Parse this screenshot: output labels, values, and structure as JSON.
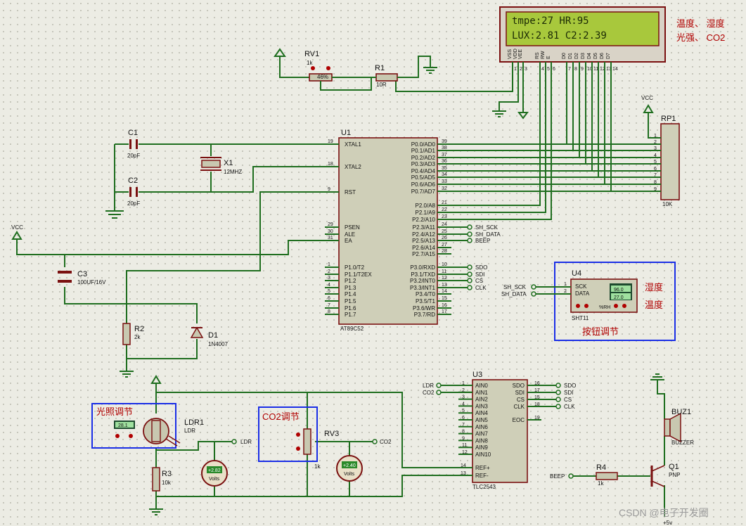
{
  "lcd": {
    "line1": "tmpe:27 HR:95",
    "line2": "LUX:2.81 C2:2.39",
    "pins": [
      "VSS",
      "VDD",
      "VEE",
      "RS",
      "RW",
      "E",
      "D0",
      "D1",
      "D2",
      "D3",
      "D4",
      "D5",
      "D6",
      "D7"
    ],
    "pin_numbers": [
      "1",
      "2",
      "3",
      "4",
      "5",
      "6",
      "7",
      "8",
      "9",
      "10",
      "11",
      "12",
      "13",
      "14"
    ]
  },
  "lcd_notes": {
    "line1": "温度、 湿度",
    "line2": "光强、 CO2"
  },
  "rv1": {
    "ref": "RV1",
    "value": "1k",
    "pct": "46%"
  },
  "r1": {
    "ref": "R1",
    "value": "10R"
  },
  "c1": {
    "ref": "C1",
    "value": "20pF"
  },
  "c2": {
    "ref": "C2",
    "value": "20pF"
  },
  "x1": {
    "ref": "X1",
    "value": "12MHZ"
  },
  "c3": {
    "ref": "C3",
    "value": "100UF/16V"
  },
  "r2": {
    "ref": "R2",
    "value": "2k"
  },
  "d1": {
    "ref": "D1",
    "value": "1N4007"
  },
  "vcc": "VCC",
  "rp1": {
    "ref": "RP1",
    "value": "10K",
    "pins": [
      "1",
      "2",
      "3",
      "4",
      "5",
      "6",
      "7",
      "8",
      "9"
    ]
  },
  "u1": {
    "ref": "U1",
    "part": "AT89C52",
    "left_pins": [
      {
        "n": "19",
        "l": "XTAL1"
      },
      {
        "n": "18",
        "l": "XTAL2"
      },
      {
        "n": "9",
        "l": "RST"
      },
      {
        "n": "29",
        "l": "PSEN"
      },
      {
        "n": "30",
        "l": "ALE"
      },
      {
        "n": "31",
        "l": "EA"
      },
      {
        "n": "1",
        "l": "P1.0/T2"
      },
      {
        "n": "2",
        "l": "P1.1/T2EX"
      },
      {
        "n": "3",
        "l": "P1.2"
      },
      {
        "n": "4",
        "l": "P1.3"
      },
      {
        "n": "5",
        "l": "P1.4"
      },
      {
        "n": "6",
        "l": "P1.5"
      },
      {
        "n": "7",
        "l": "P1.6"
      },
      {
        "n": "8",
        "l": "P1.7"
      }
    ],
    "right_pins": [
      {
        "n": "39",
        "l": "P0.0/AD0"
      },
      {
        "n": "38",
        "l": "P0.1/AD1"
      },
      {
        "n": "37",
        "l": "P0.2/AD2"
      },
      {
        "n": "36",
        "l": "P0.3/AD3"
      },
      {
        "n": "35",
        "l": "P0.4/AD4"
      },
      {
        "n": "34",
        "l": "P0.5/AD5"
      },
      {
        "n": "33",
        "l": "P0.6/AD6"
      },
      {
        "n": "32",
        "l": "P0.7/AD7"
      },
      {
        "n": "21",
        "l": "P2.0/A8"
      },
      {
        "n": "22",
        "l": "P2.1/A9"
      },
      {
        "n": "23",
        "l": "P2.2/A10"
      },
      {
        "n": "24",
        "l": "P2.3/A11"
      },
      {
        "n": "25",
        "l": "P2.4/A12"
      },
      {
        "n": "26",
        "l": "P2.5/A13"
      },
      {
        "n": "27",
        "l": "P2.6/A14"
      },
      {
        "n": "28",
        "l": "P2.7/A15"
      },
      {
        "n": "10",
        "l": "P3.0/RXD"
      },
      {
        "n": "11",
        "l": "P3.1/TXD"
      },
      {
        "n": "12",
        "l": "P3.2/INT0"
      },
      {
        "n": "13",
        "l": "P3.3/INT1"
      },
      {
        "n": "14",
        "l": "P3.4/T0"
      },
      {
        "n": "15",
        "l": "P3.5/T1"
      },
      {
        "n": "16",
        "l": "P3.6/WR"
      },
      {
        "n": "17",
        "l": "P3.7/RD"
      }
    ]
  },
  "u1_nets": {
    "p23": "SH_SCK",
    "p24": "SH_DATA",
    "p25": "BEEP",
    "p30": "SDO",
    "p31": "SDI",
    "p32": "CS",
    "p33": "CLK"
  },
  "u4": {
    "ref": "U4",
    "part": "SHT11",
    "sck": "SCK",
    "data": "DATA",
    "temp": "96.0",
    "hum": "27.0",
    "rh": "%RH",
    "net_sck": "SH_SCK",
    "net_data": "SH_DATA",
    "pin_sck": "1",
    "pin_data": "2",
    "note1": "湿度",
    "note2": "温度",
    "caption": "按钮调节"
  },
  "ldr1": {
    "ref": "LDR1",
    "value": "LDR",
    "display": "28.1",
    "caption": "光照调节"
  },
  "r3": {
    "ref": "R3",
    "value": "10k"
  },
  "vm1": {
    "value": "+2.82",
    "unit": "Volts"
  },
  "ldr_net": "LDR",
  "rv3": {
    "ref": "RV3",
    "value": "1k",
    "caption": "CO2调节"
  },
  "vm2": {
    "value": "+2.40",
    "unit": "Volts"
  },
  "co2_net": "CO2",
  "u3": {
    "ref": "U3",
    "part": "TLC2543",
    "left_pins": [
      {
        "n": "1",
        "l": "AIN0"
      },
      {
        "n": "2",
        "l": "AIN1"
      },
      {
        "n": "3",
        "l": "AIN2"
      },
      {
        "n": "4",
        "l": "AIN3"
      },
      {
        "n": "5",
        "l": "AIN4"
      },
      {
        "n": "6",
        "l": "AIN5"
      },
      {
        "n": "7",
        "l": "AIN6"
      },
      {
        "n": "8",
        "l": "AIN7"
      },
      {
        "n": "9",
        "l": "AIN8"
      },
      {
        "n": "11",
        "l": "AIN9"
      },
      {
        "n": "12",
        "l": "AIN10"
      }
    ],
    "right_pins": [
      {
        "n": "16",
        "l": "SDO"
      },
      {
        "n": "17",
        "l": "SDI"
      },
      {
        "n": "15",
        "l": "CS"
      },
      {
        "n": "18",
        "l": "CLK"
      },
      {
        "n": "19",
        "l": "EOC"
      }
    ],
    "ref_pins": [
      {
        "n": "14",
        "l": "REF+"
      },
      {
        "n": "13",
        "l": "REF-"
      }
    ],
    "net_ldr": "LDR",
    "net_co2": "CO2",
    "nets_right": [
      "SDO",
      "SDI",
      "CS",
      "CLK"
    ]
  },
  "buz1": {
    "ref": "BUZ1",
    "value": "BUZZER"
  },
  "q1": {
    "ref": "Q1",
    "value": "PNP"
  },
  "r4": {
    "ref": "R4",
    "value": "1k"
  },
  "beep_net": "BEEP",
  "q1_supply": "+5v",
  "watermark": "CSDN @电子开发圈",
  "colors": {
    "wire": "#1f6e1f",
    "component": "#7a1010",
    "lcd_screen": "#a8c83c",
    "note": "#b00000",
    "box": "#1a2ee6",
    "chip": "#cfcfb8"
  }
}
